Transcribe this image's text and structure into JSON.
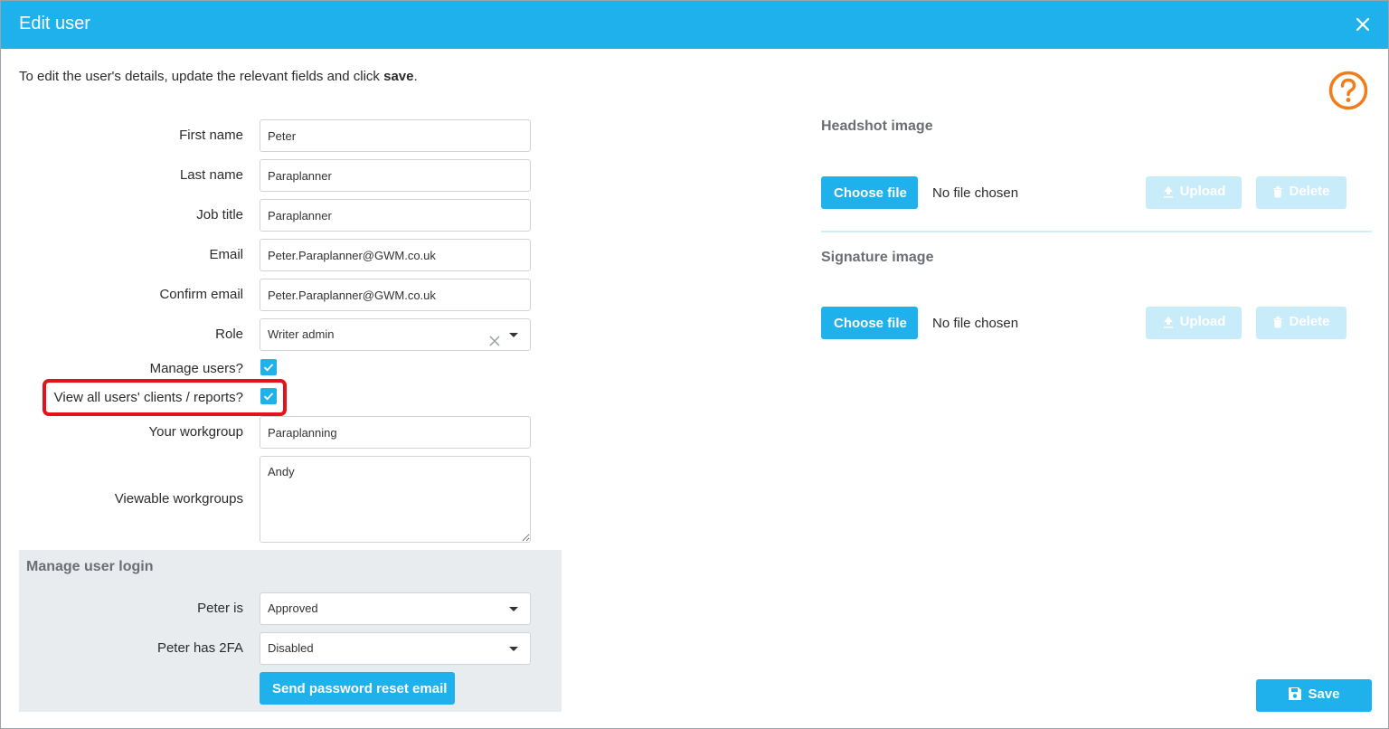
{
  "dialog": {
    "title": "Edit user",
    "intro_text": "To edit the user's details, update the relevant fields and click ",
    "intro_bold": "save",
    "intro_end": "."
  },
  "form": {
    "first_name": {
      "label": "First name",
      "value": "Peter"
    },
    "last_name": {
      "label": "Last name",
      "value": "Paraplanner"
    },
    "job_title": {
      "label": "Job title",
      "value": "Paraplanner"
    },
    "email": {
      "label": "Email",
      "value": "Peter.Paraplanner@GWM.co.uk"
    },
    "confirm_email": {
      "label": "Confirm email",
      "value": "Peter.Paraplanner@GWM.co.uk"
    },
    "role": {
      "label": "Role",
      "value": "Writer admin"
    },
    "manage_users": {
      "label": "Manage users?",
      "checked": true
    },
    "view_all": {
      "label": "View all users' clients / reports?",
      "checked": true
    },
    "workgroup": {
      "label": "Your workgroup",
      "value": "Paraplanning"
    },
    "viewable_workgroups": {
      "label": "Viewable workgroups",
      "value": "Andy"
    }
  },
  "login": {
    "title": "Manage user login",
    "status": {
      "label": "Peter is",
      "value": "Approved"
    },
    "twofa": {
      "label": "Peter has 2FA",
      "value": "Disabled"
    },
    "reset_button": "Send password reset email"
  },
  "images": {
    "headshot": {
      "title": "Headshot image",
      "choose": "Choose file",
      "status": "No file chosen",
      "upload": "Upload",
      "delete": "Delete"
    },
    "signature": {
      "title": "Signature image",
      "choose": "Choose file",
      "status": "No file chosen",
      "upload": "Upload",
      "delete": "Delete"
    }
  },
  "footer": {
    "save": "Save"
  },
  "colors": {
    "accent": "#1eb1ec",
    "help": "#f07c1a",
    "highlight": "#e3121d"
  },
  "icons": [
    "close-icon",
    "help-icon",
    "check-icon",
    "clear-icon",
    "chevron-down-icon",
    "upload-icon",
    "trash-icon",
    "save-icon"
  ]
}
